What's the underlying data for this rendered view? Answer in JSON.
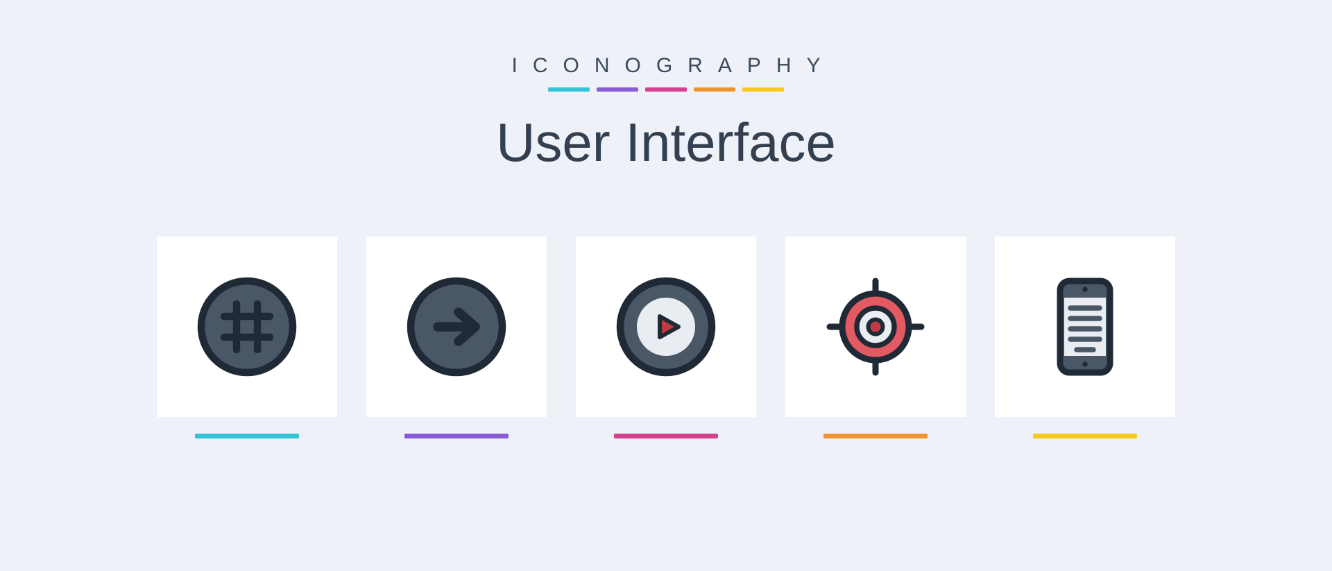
{
  "header": {
    "brand": "ICONOGRAPHY",
    "title": "User Interface"
  },
  "palette": {
    "cyan": "#35c3d6",
    "purple": "#8a5bd6",
    "magenta": "#d4418e",
    "orange": "#f09433",
    "yellow": "#f6c921",
    "icon_dark": "#2e3a4a",
    "icon_fill": "#4a5766",
    "icon_accent": "#e35a63",
    "icon_accent_dark": "#c23a45",
    "icon_light": "#e9edf2"
  },
  "icons": [
    {
      "name": "hashtag-circle-icon",
      "underline": "cyan"
    },
    {
      "name": "arrow-right-circle-icon",
      "underline": "purple"
    },
    {
      "name": "play-circle-icon",
      "underline": "magenta"
    },
    {
      "name": "target-icon",
      "underline": "orange"
    },
    {
      "name": "mobile-text-icon",
      "underline": "yellow"
    }
  ]
}
